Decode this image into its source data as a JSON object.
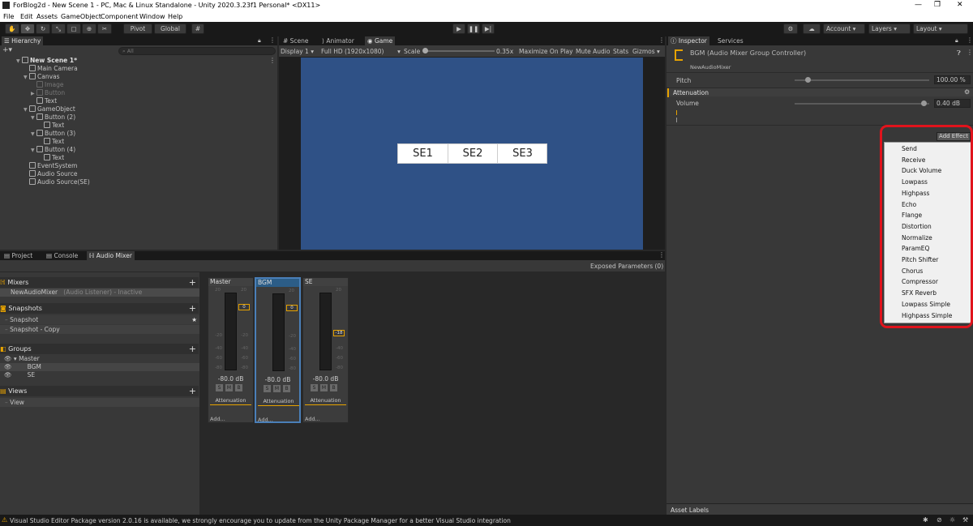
{
  "window": {
    "title": "ForBlog2d - New Scene 1 - PC, Mac & Linux Standalone - Unity 2020.3.23f1 Personal* <DX11>"
  },
  "menu": [
    "File",
    "Edit",
    "Assets",
    "GameObject",
    "Component",
    "Window",
    "Help"
  ],
  "toolbar": {
    "pivot": "Pivot",
    "global": "Global",
    "account": "Account",
    "layers": "Layers",
    "layout": "Layout"
  },
  "hierarchy": {
    "tab": "Hierarchy",
    "search_placeholder": "All",
    "items": [
      {
        "label": "New Scene 1*",
        "dim": false
      },
      {
        "label": "Main Camera",
        "dim": false
      },
      {
        "label": "Canvas",
        "dim": false
      },
      {
        "label": "Image",
        "dim": true
      },
      {
        "label": "Button",
        "dim": true
      },
      {
        "label": "Text",
        "dim": false
      },
      {
        "label": "GameObject",
        "dim": false
      },
      {
        "label": "Button (2)",
        "dim": false
      },
      {
        "label": "Text",
        "dim": false
      },
      {
        "label": "Button (3)",
        "dim": false
      },
      {
        "label": "Text",
        "dim": false
      },
      {
        "label": "Button (4)",
        "dim": false
      },
      {
        "label": "Text",
        "dim": false
      },
      {
        "label": "EventSystem",
        "dim": false
      },
      {
        "label": "Audio Source",
        "dim": false
      },
      {
        "label": "Audio Source(SE)",
        "dim": false
      }
    ]
  },
  "game": {
    "tabs": [
      "Scene",
      "Animator",
      "Game"
    ],
    "display": "Display 1",
    "resolution": "Full HD (1920x1080)",
    "scale_label": "Scale",
    "scale_value": "0.35x",
    "maximize": "Maximize On Play",
    "mute": "Mute Audio",
    "stats": "Stats",
    "gizmos": "Gizmos",
    "buttons": [
      "SE1",
      "SE2",
      "SE3"
    ],
    "bg": "#2f5186"
  },
  "bottom": {
    "tabs": [
      "Project",
      "Console",
      "Audio Mixer"
    ],
    "exposed": "Exposed Parameters (0)"
  },
  "mixer": {
    "mixers_label": "Mixers",
    "mixer_name": "NewAudioMixer",
    "mixer_note": "(Audio Listener) - Inactive",
    "snapshots_label": "Snapshots",
    "snapshots": [
      "Snapshot",
      "Snapshot - Copy"
    ],
    "groups_label": "Groups",
    "groups": [
      "Master",
      "BGM",
      "SE"
    ],
    "views_label": "Views",
    "views": [
      "View"
    ],
    "strips": [
      {
        "name": "Master",
        "fader": "0",
        "db": "-80.0 dB",
        "attenuation": "Attenuation",
        "add": "Add..."
      },
      {
        "name": "BGM",
        "fader": "0",
        "db": "-80.0 dB",
        "attenuation": "Attenuation",
        "add": "Add..."
      },
      {
        "name": "SE",
        "fader": "-18",
        "db": "-80.0 dB",
        "attenuation": "Attenuation",
        "add": "Add..."
      }
    ],
    "scale_labels": [
      "20",
      "0",
      "-20",
      "-40",
      "-60",
      "-80"
    ],
    "smb": [
      "S",
      "M",
      "B"
    ]
  },
  "inspector": {
    "tabs": [
      "Inspector",
      "Services"
    ],
    "title": "BGM (Audio Mixer Group Controller)",
    "subtitle": "NewAudioMixer",
    "pitch_label": "Pitch",
    "pitch_value": "100.00 %",
    "pitch_level": 0.1,
    "attenuation_label": "Attenuation",
    "volume_label": "Volume",
    "volume_value": "0.40 dB",
    "volume_level": 0.96,
    "add_effect": "Add Effect",
    "effects": [
      "Send",
      "Receive",
      "Duck Volume",
      "Lowpass",
      "Highpass",
      "Echo",
      "Flange",
      "Distortion",
      "Normalize",
      "ParamEQ",
      "Pitch Shifter",
      "Chorus",
      "Compressor",
      "SFX Reverb",
      "Lowpass Simple",
      "Highpass Simple"
    ],
    "asset_labels": "Asset Labels"
  },
  "status": {
    "message": "Visual Studio Editor Package version 2.0.16 is available, we strongly encourage you to update from the Unity Package Manager for a better Visual Studio integration"
  },
  "colors": {
    "accent_orange": "#e6a200",
    "highlight_red": "#e0131c",
    "selection": "#2c5d87"
  }
}
